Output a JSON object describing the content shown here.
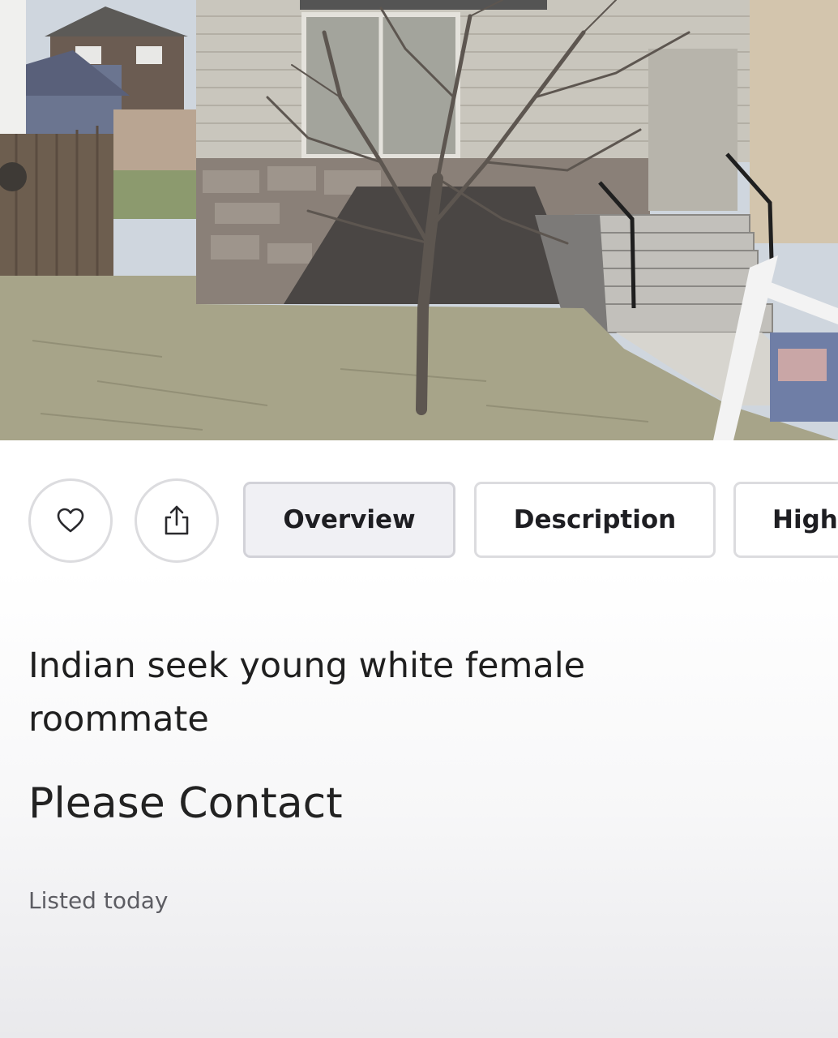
{
  "actions": {
    "favorite_icon": "heart-icon",
    "share_icon": "share-icon"
  },
  "tabs": [
    {
      "label": "Overview",
      "active": true
    },
    {
      "label": "Description",
      "active": false
    },
    {
      "label": "Highl",
      "active": false
    }
  ],
  "listing": {
    "title": "Indian seek young white female roommate",
    "price": "Please Contact",
    "listed": "Listed today"
  }
}
